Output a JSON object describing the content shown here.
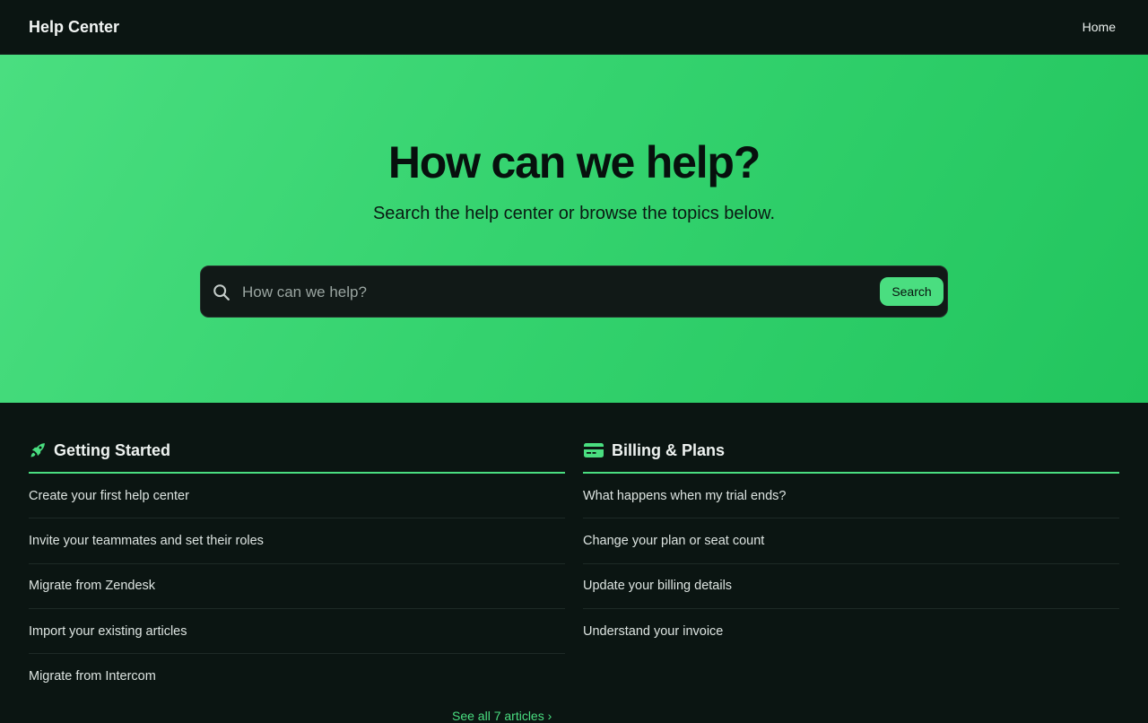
{
  "header": {
    "brand": "Help Center",
    "nav": {
      "home": "Home"
    }
  },
  "hero": {
    "title": "How can we help?",
    "subtitle": "Search the help center or browse the topics below.",
    "search": {
      "placeholder": "How can we help?",
      "value": "",
      "button_label": "Search",
      "icon": "search-icon"
    }
  },
  "sections": {
    "getting_started": {
      "title": "Getting Started",
      "icon": "rocket-icon",
      "articles": [
        "Create your first help center",
        "Invite your teammates and set their roles",
        "Migrate from Zendesk",
        "Import your existing articles",
        "Migrate from Intercom"
      ],
      "see_all": "See all 7 articles ›"
    },
    "billing": {
      "title": "Billing & Plans",
      "icon": "credit-card-icon",
      "articles": [
        "What happens when my trial ends?",
        "Change your plan or seat count",
        "Update your billing details",
        "Understand your invoice"
      ]
    }
  },
  "colors": {
    "accent": "#4ade80",
    "background": "#0b1512",
    "hero_gradient_start": "#4ade80",
    "hero_gradient_end": "#22c55e"
  }
}
